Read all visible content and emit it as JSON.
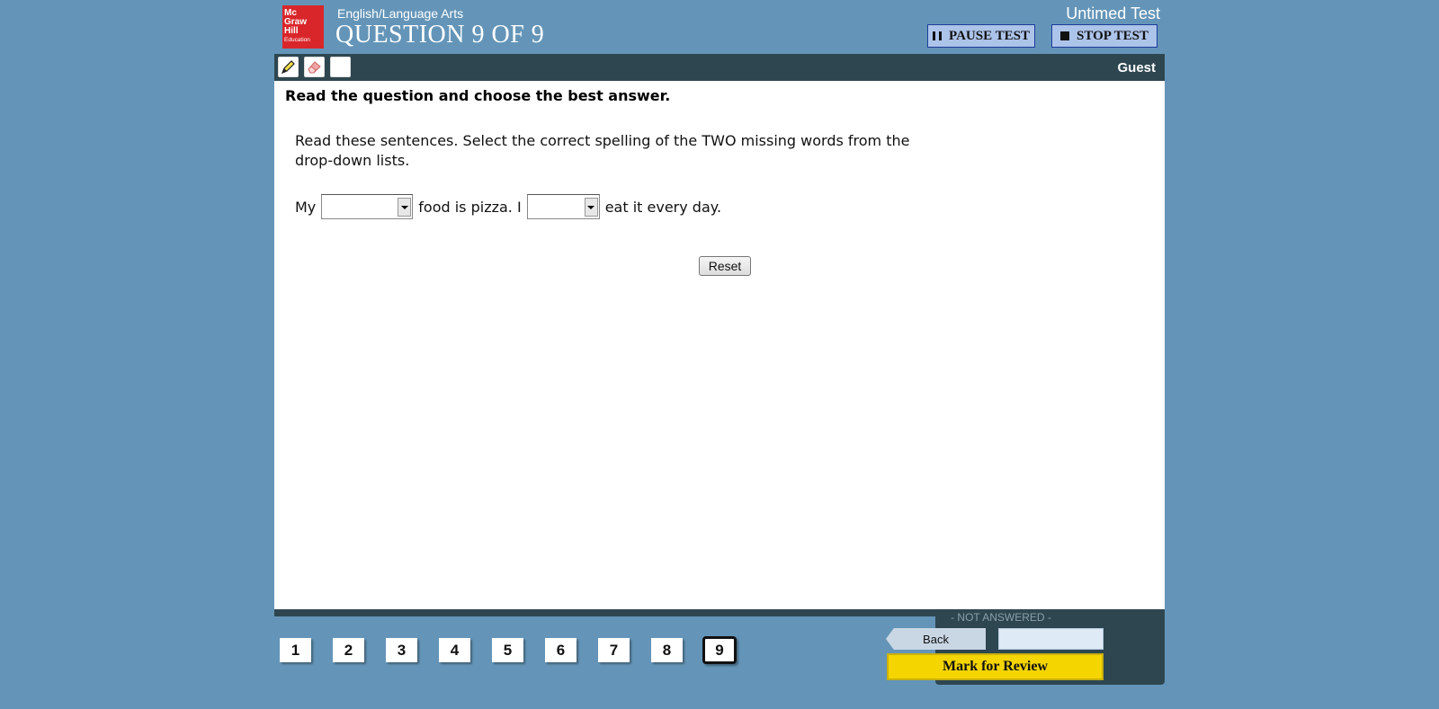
{
  "header": {
    "logo_lines": [
      "Mc",
      "Graw",
      "Hill",
      "Education"
    ],
    "subject": "English/Language Arts",
    "question_title": "QUESTION 9 OF 9",
    "test_mode": "Untimed Test",
    "pause_label": "PAUSE TEST",
    "stop_label": "STOP TEST"
  },
  "toolbar": {
    "tools": [
      "highlighter-icon",
      "eraser-icon",
      "blank-tool"
    ],
    "user": "Guest"
  },
  "question": {
    "instruction": "Read the question and choose the best answer.",
    "prompt": "Read these sentences. Select the correct spelling of the TWO missing words from the drop-down lists.",
    "sentence_part1": "My",
    "sentence_part2": "food is pizza. I",
    "sentence_part3": "eat it every day.",
    "dropdown1_value": "",
    "dropdown2_value": "",
    "reset_label": "Reset"
  },
  "navigation": {
    "status": "- NOT ANSWERED -",
    "back_label": "Back",
    "mark_label": "Mark for Review",
    "questions": [
      "1",
      "2",
      "3",
      "4",
      "5",
      "6",
      "7",
      "8",
      "9"
    ],
    "current_question": "9"
  },
  "colors": {
    "background": "#6495b8",
    "toolbar": "#2e4650",
    "logo_red": "#d9262a",
    "mark_yellow": "#f4d500"
  }
}
